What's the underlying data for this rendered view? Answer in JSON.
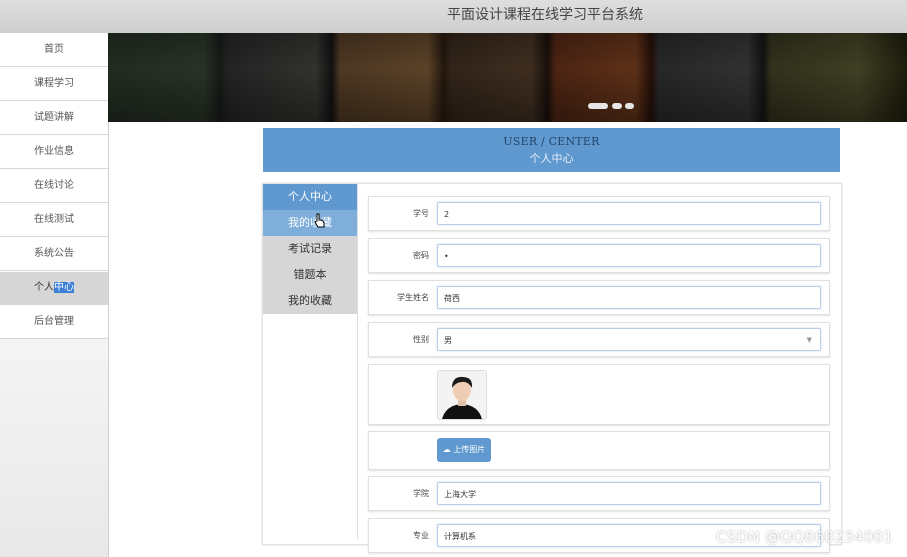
{
  "header": {
    "title": "平面设计课程在线学习平台系统"
  },
  "nav": {
    "items": [
      {
        "label": "首页"
      },
      {
        "label": "课程学习"
      },
      {
        "label": "试题讲解"
      },
      {
        "label": "作业信息"
      },
      {
        "label": "在线讨论"
      },
      {
        "label": "在线测试"
      },
      {
        "label": "系统公告"
      },
      {
        "label_a": "个人",
        "label_b": "中心"
      },
      {
        "label": "后台管理"
      }
    ]
  },
  "center": {
    "title_en": "USER / CENTER",
    "title_zh": "个人中心"
  },
  "submenu": {
    "current": "个人中心",
    "hover": "我的收藏",
    "items": [
      "考试记录",
      "错题本",
      "我的收藏"
    ]
  },
  "form": {
    "student_id": {
      "label": "学号",
      "value": "2"
    },
    "password": {
      "label": "密码",
      "value": "•"
    },
    "name": {
      "label": "学生姓名",
      "value": "荷西"
    },
    "gender": {
      "label": "性别",
      "value": "男"
    },
    "upload": {
      "label": "上传图片"
    },
    "college": {
      "label": "学院",
      "value": "上海大学"
    },
    "major": {
      "label": "专业",
      "value": "计算机系"
    }
  },
  "watermark": "CSDN @QQ860234001",
  "colors": {
    "accent": "#5f99cf",
    "nav_active": "#d6d6d6"
  }
}
